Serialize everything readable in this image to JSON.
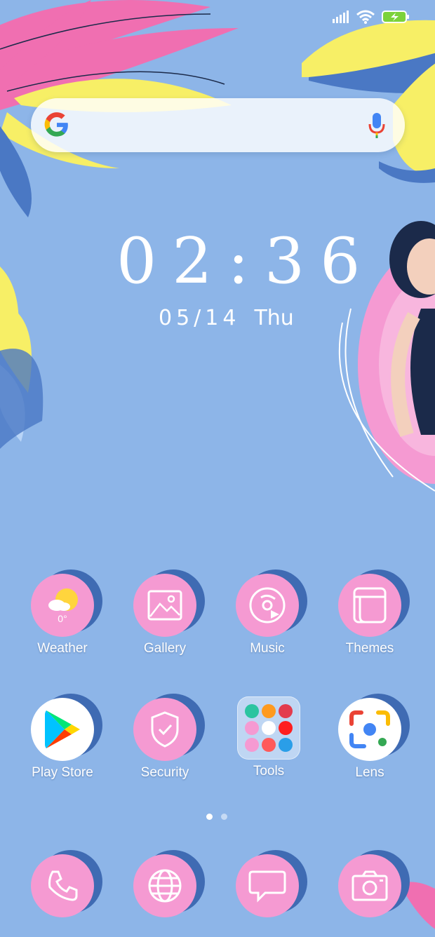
{
  "clock": {
    "time": "02:36",
    "date": "05/14",
    "weekday": "Thu"
  },
  "search": {
    "provider_icon": "google-g-icon",
    "voice_icon": "mic-icon"
  },
  "status": {
    "icons": [
      "signal-icon",
      "wifi-icon",
      "battery-charging-icon"
    ]
  },
  "apps": [
    {
      "id": "weather",
      "label": "Weather",
      "icon": "weather-icon",
      "extra": "0°"
    },
    {
      "id": "gallery",
      "label": "Gallery",
      "icon": "gallery-icon"
    },
    {
      "id": "music",
      "label": "Music",
      "icon": "music-icon"
    },
    {
      "id": "themes",
      "label": "Themes",
      "icon": "themes-icon"
    },
    {
      "id": "play-store",
      "label": "Play Store",
      "icon": "play-store-icon"
    },
    {
      "id": "security",
      "label": "Security",
      "icon": "security-shield-icon"
    },
    {
      "id": "tools",
      "label": "Tools",
      "icon": "folder-icon"
    },
    {
      "id": "lens",
      "label": "Lens",
      "icon": "google-lens-icon"
    }
  ],
  "dock": [
    {
      "id": "phone",
      "icon": "phone-icon"
    },
    {
      "id": "browser",
      "icon": "globe-icon"
    },
    {
      "id": "messages",
      "icon": "message-icon"
    },
    {
      "id": "camera",
      "icon": "camera-icon"
    }
  ],
  "pager": {
    "pages": 2,
    "current": 1
  },
  "colors": {
    "background": "#8db5e8",
    "icon_pink": "#f59ad2",
    "icon_shadow": "#3f6bb3"
  }
}
